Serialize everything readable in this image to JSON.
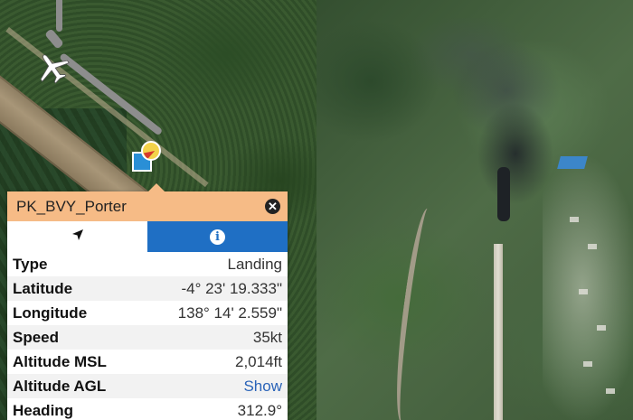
{
  "popup": {
    "title": "PK_BVY_Porter",
    "close_icon": "close-icon",
    "tabs": [
      {
        "icon": "navigation-arrow-icon",
        "active": false
      },
      {
        "icon": "info-icon",
        "active": true
      }
    ],
    "rows": [
      {
        "label": "Type",
        "value": "Landing"
      },
      {
        "label": "Latitude",
        "value": "-4° 23' 19.333\""
      },
      {
        "label": "Longitude",
        "value": "138° 14' 2.559\""
      },
      {
        "label": "Speed",
        "value": "35kt"
      },
      {
        "label": "Altitude MSL",
        "value": "2,014ft"
      },
      {
        "label": "Altitude AGL",
        "value": "Show"
      },
      {
        "label": "Heading",
        "value": "312.9°"
      }
    ]
  },
  "map": {
    "aircraft_icon": "airplane-icon",
    "marker_icon": "aircraft-position-marker"
  },
  "colors": {
    "header": "#f6bb86",
    "info_tab": "#1f6fc4",
    "link": "#2a63b8"
  }
}
